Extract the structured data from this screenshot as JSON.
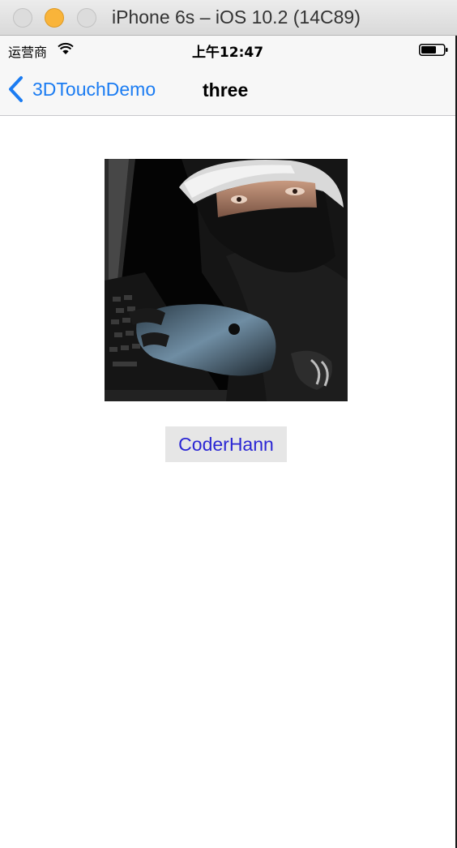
{
  "window": {
    "title": "iPhone 6s – iOS 10.2 (14C89)"
  },
  "status_bar": {
    "carrier": "运营商",
    "time": "上午12:47"
  },
  "nav": {
    "back_label": "3DTouchDemo",
    "title": "three"
  },
  "content": {
    "button_label": "CoderHann"
  },
  "colors": {
    "accent": "#1b7cf2",
    "button_text": "#2a26d4",
    "button_bg": "#e6e6e6"
  }
}
